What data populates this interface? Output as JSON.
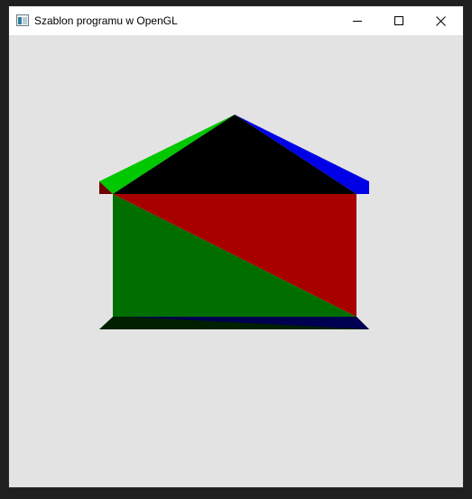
{
  "window": {
    "title": "Szablon programu w OpenGL",
    "icon": "opengl-app-icon",
    "controls": {
      "minimize_icon": "minimize-icon",
      "maximize_icon": "maximize-icon",
      "close_icon": "close-icon"
    },
    "background_color": "#e3e3e3"
  },
  "scene": {
    "description_colors": {
      "front_red": "#a80000",
      "front_green": "#006e00",
      "roof_black": "#000000",
      "roof_green": "#00c800",
      "roof_blue": "#0000e6",
      "eave_dark_red": "#6e0000",
      "base_dark_green": "#002000",
      "base_navy": "#000050"
    }
  }
}
